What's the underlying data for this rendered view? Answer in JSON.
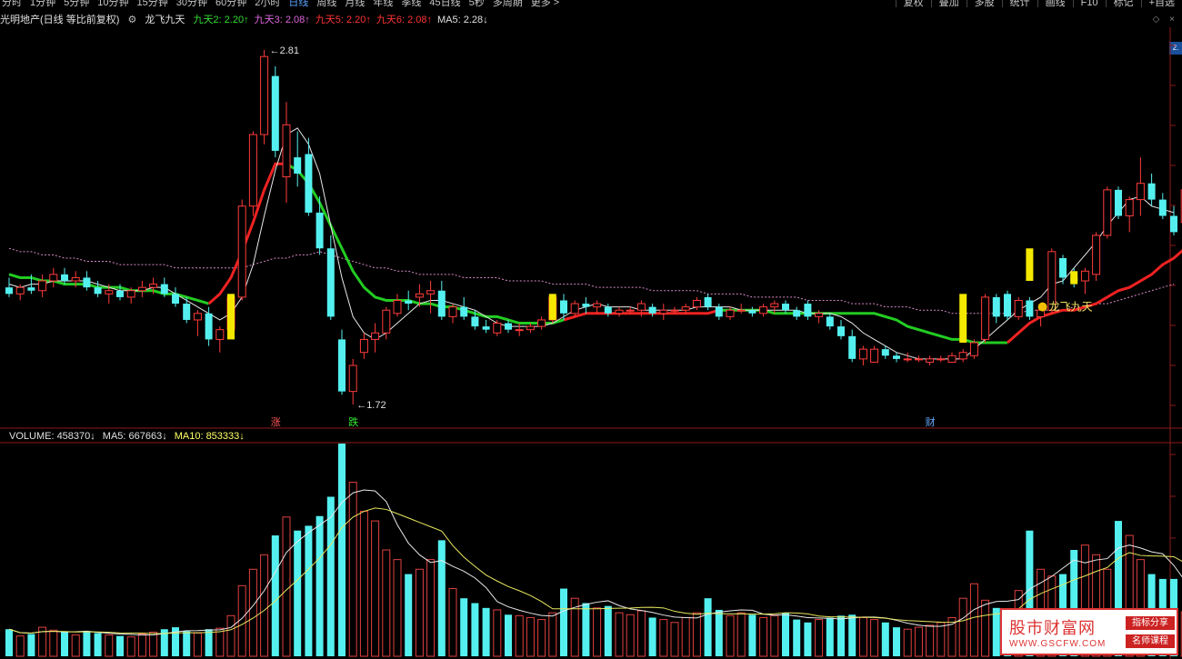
{
  "toolbar": {
    "periods": [
      "分时",
      "1分钟",
      "5分钟",
      "10分钟",
      "15分钟",
      "30分钟",
      "60分钟",
      "2小时",
      "日线",
      "周线",
      "月线",
      "年线",
      "季线",
      "45日线",
      "5秒",
      "多周期",
      "更多 >"
    ],
    "active_period": "日线",
    "tools": [
      "复权",
      "叠加",
      "多股",
      "统计",
      "画线",
      "F10",
      "标记",
      "+自选"
    ]
  },
  "info": {
    "stock": "光明地产(日线 等比前复权)",
    "indicator_name": "龙飞九天",
    "items": [
      {
        "label": "九天2: 2.20↑",
        "color": "#33dd33"
      },
      {
        "label": "九天3: 2.08↑",
        "color": "#dd66dd"
      },
      {
        "label": "九天5: 2.20↑",
        "color": "#ff3333"
      },
      {
        "label": "九天6: 2.08↑",
        "color": "#ff3333"
      },
      {
        "label": "MA5: 2.28↓",
        "color": "#e0e0e0"
      }
    ]
  },
  "price_badge": "2.",
  "annotations": {
    "high": "2.81",
    "low": "1.72",
    "signal_label": "龙飞九天",
    "markers": [
      {
        "text": "涨",
        "color": "#ff5555"
      },
      {
        "text": "跌",
        "color": "#33ee33"
      },
      {
        "text": "财",
        "color": "#66aaff"
      }
    ]
  },
  "volume": {
    "items": [
      {
        "label": "VOLUME: 458370↓",
        "color": "#e0e0e0"
      },
      {
        "label": "MA5: 667663↓",
        "color": "#e0e0e0"
      },
      {
        "label": "MA10: 853333↓",
        "color": "#ffff66"
      }
    ]
  },
  "watermark": {
    "title": "股市财富网",
    "url": "WWW.GSCFW.COM",
    "badge1": "指标分享",
    "badge2": "名师课程"
  },
  "chart_data": {
    "type": "candlestick",
    "y_range": [
      1.65,
      2.88
    ],
    "candles": [
      {
        "o": 2.08,
        "h": 2.11,
        "l": 2.05,
        "c": 2.06
      },
      {
        "o": 2.06,
        "h": 2.09,
        "l": 2.04,
        "c": 2.08
      },
      {
        "o": 2.08,
        "h": 2.12,
        "l": 2.06,
        "c": 2.07
      },
      {
        "o": 2.07,
        "h": 2.12,
        "l": 2.05,
        "c": 2.1
      },
      {
        "o": 2.1,
        "h": 2.14,
        "l": 2.08,
        "c": 2.12
      },
      {
        "o": 2.12,
        "h": 2.14,
        "l": 2.09,
        "c": 2.1
      },
      {
        "o": 2.1,
        "h": 2.13,
        "l": 2.08,
        "c": 2.11
      },
      {
        "o": 2.11,
        "h": 2.13,
        "l": 2.07,
        "c": 2.08
      },
      {
        "o": 2.08,
        "h": 2.1,
        "l": 2.05,
        "c": 2.06
      },
      {
        "o": 2.06,
        "h": 2.09,
        "l": 2.03,
        "c": 2.07
      },
      {
        "o": 2.07,
        "h": 2.09,
        "l": 2.04,
        "c": 2.05
      },
      {
        "o": 2.05,
        "h": 2.08,
        "l": 2.03,
        "c": 2.07
      },
      {
        "o": 2.07,
        "h": 2.1,
        "l": 2.05,
        "c": 2.08
      },
      {
        "o": 2.08,
        "h": 2.11,
        "l": 2.06,
        "c": 2.09
      },
      {
        "o": 2.09,
        "h": 2.11,
        "l": 2.05,
        "c": 2.06
      },
      {
        "o": 2.06,
        "h": 2.08,
        "l": 2.02,
        "c": 2.03
      },
      {
        "o": 2.03,
        "h": 2.05,
        "l": 1.97,
        "c": 1.98
      },
      {
        "o": 1.98,
        "h": 2.01,
        "l": 1.93,
        "c": 2.0
      },
      {
        "o": 2.0,
        "h": 2.02,
        "l": 1.9,
        "c": 1.92
      },
      {
        "o": 1.92,
        "h": 1.96,
        "l": 1.88,
        "c": 1.95
      },
      {
        "o": 1.95,
        "h": 2.06,
        "l": 1.94,
        "c": 2.05
      },
      {
        "o": 2.05,
        "h": 2.35,
        "l": 2.04,
        "c": 2.33
      },
      {
        "o": 2.33,
        "h": 2.56,
        "l": 2.3,
        "c": 2.55
      },
      {
        "o": 2.55,
        "h": 2.81,
        "l": 2.52,
        "c": 2.79
      },
      {
        "o": 2.73,
        "h": 2.76,
        "l": 2.48,
        "c": 2.5
      },
      {
        "o": 2.42,
        "h": 2.65,
        "l": 2.34,
        "c": 2.58
      },
      {
        "o": 2.48,
        "h": 2.56,
        "l": 2.39,
        "c": 2.43
      },
      {
        "o": 2.49,
        "h": 2.54,
        "l": 2.3,
        "c": 2.31
      },
      {
        "o": 2.31,
        "h": 2.36,
        "l": 2.18,
        "c": 2.2
      },
      {
        "o": 2.2,
        "h": 2.24,
        "l": 1.98,
        "c": 1.99
      },
      {
        "o": 1.92,
        "h": 1.95,
        "l": 1.75,
        "c": 1.76
      },
      {
        "o": 1.76,
        "h": 1.86,
        "l": 1.72,
        "c": 1.84
      },
      {
        "o": 1.88,
        "h": 1.94,
        "l": 1.86,
        "c": 1.92
      },
      {
        "o": 1.92,
        "h": 1.97,
        "l": 1.88,
        "c": 1.94
      },
      {
        "o": 1.94,
        "h": 2.02,
        "l": 1.92,
        "c": 2.01
      },
      {
        "o": 2.0,
        "h": 2.06,
        "l": 1.99,
        "c": 2.04
      },
      {
        "o": 2.04,
        "h": 2.07,
        "l": 2.01,
        "c": 2.03
      },
      {
        "o": 2.05,
        "h": 2.09,
        "l": 2.02,
        "c": 2.06
      },
      {
        "o": 2.06,
        "h": 2.1,
        "l": 2.0,
        "c": 2.07
      },
      {
        "o": 2.07,
        "h": 2.1,
        "l": 1.98,
        "c": 1.99
      },
      {
        "o": 1.99,
        "h": 2.03,
        "l": 1.97,
        "c": 2.02
      },
      {
        "o": 2.02,
        "h": 2.05,
        "l": 1.98,
        "c": 1.99
      },
      {
        "o": 1.99,
        "h": 2.01,
        "l": 1.95,
        "c": 1.96
      },
      {
        "o": 1.96,
        "h": 1.98,
        "l": 1.94,
        "c": 1.95
      },
      {
        "o": 1.94,
        "h": 1.98,
        "l": 1.93,
        "c": 1.97
      },
      {
        "o": 1.97,
        "h": 1.98,
        "l": 1.94,
        "c": 1.95
      },
      {
        "o": 1.95,
        "h": 1.97,
        "l": 1.93,
        "c": 1.95
      },
      {
        "o": 1.95,
        "h": 1.97,
        "l": 1.94,
        "c": 1.96
      },
      {
        "o": 1.96,
        "h": 1.99,
        "l": 1.95,
        "c": 1.98
      },
      {
        "o": 1.98,
        "h": 2.06,
        "l": 1.97,
        "c": 2.05
      },
      {
        "o": 2.04,
        "h": 2.06,
        "l": 1.98,
        "c": 2.0
      },
      {
        "o": 2.0,
        "h": 2.04,
        "l": 1.99,
        "c": 2.03
      },
      {
        "o": 2.03,
        "h": 2.05,
        "l": 2.0,
        "c": 2.02
      },
      {
        "o": 2.02,
        "h": 2.04,
        "l": 2.0,
        "c": 2.03
      },
      {
        "o": 2.02,
        "h": 2.03,
        "l": 1.99,
        "c": 2.0
      },
      {
        "o": 2.0,
        "h": 2.02,
        "l": 1.99,
        "c": 2.01
      },
      {
        "o": 2.01,
        "h": 2.02,
        "l": 2.0,
        "c": 2.01
      },
      {
        "o": 2.01,
        "h": 2.04,
        "l": 1.99,
        "c": 2.03
      },
      {
        "o": 2.02,
        "h": 2.03,
        "l": 1.99,
        "c": 2.0
      },
      {
        "o": 2.0,
        "h": 2.03,
        "l": 1.98,
        "c": 2.01
      },
      {
        "o": 2.01,
        "h": 2.02,
        "l": 2.0,
        "c": 2.01
      },
      {
        "o": 2.01,
        "h": 2.03,
        "l": 2.0,
        "c": 2.02
      },
      {
        "o": 2.02,
        "h": 2.05,
        "l": 2.01,
        "c": 2.04
      },
      {
        "o": 2.05,
        "h": 2.06,
        "l": 2.01,
        "c": 2.02
      },
      {
        "o": 2.02,
        "h": 2.03,
        "l": 1.98,
        "c": 1.99
      },
      {
        "o": 1.99,
        "h": 2.02,
        "l": 1.98,
        "c": 2.01
      },
      {
        "o": 2.01,
        "h": 2.03,
        "l": 2.0,
        "c": 2.01
      },
      {
        "o": 2.01,
        "h": 2.02,
        "l": 1.99,
        "c": 2.0
      },
      {
        "o": 2.0,
        "h": 2.03,
        "l": 1.99,
        "c": 2.02
      },
      {
        "o": 2.02,
        "h": 2.04,
        "l": 2.0,
        "c": 2.03
      },
      {
        "o": 2.03,
        "h": 2.04,
        "l": 2.0,
        "c": 2.01
      },
      {
        "o": 2.01,
        "h": 2.02,
        "l": 1.98,
        "c": 1.99
      },
      {
        "o": 2.03,
        "h": 2.04,
        "l": 1.98,
        "c": 1.99
      },
      {
        "o": 1.99,
        "h": 2.01,
        "l": 1.97,
        "c": 2.0
      },
      {
        "o": 1.99,
        "h": 2.0,
        "l": 1.95,
        "c": 1.96
      },
      {
        "o": 1.96,
        "h": 1.98,
        "l": 1.92,
        "c": 1.93
      },
      {
        "o": 1.93,
        "h": 1.95,
        "l": 1.85,
        "c": 1.86
      },
      {
        "o": 1.86,
        "h": 1.9,
        "l": 1.84,
        "c": 1.89
      },
      {
        "o": 1.85,
        "h": 1.9,
        "l": 1.85,
        "c": 1.89
      },
      {
        "o": 1.89,
        "h": 1.9,
        "l": 1.86,
        "c": 1.87
      },
      {
        "o": 1.87,
        "h": 1.88,
        "l": 1.85,
        "c": 1.86
      },
      {
        "o": 1.86,
        "h": 1.88,
        "l": 1.85,
        "c": 1.86
      },
      {
        "o": 1.86,
        "h": 1.87,
        "l": 1.85,
        "c": 1.86
      },
      {
        "o": 1.85,
        "h": 1.87,
        "l": 1.84,
        "c": 1.86
      },
      {
        "o": 1.86,
        "h": 1.87,
        "l": 1.85,
        "c": 1.86
      },
      {
        "o": 1.85,
        "h": 1.88,
        "l": 1.85,
        "c": 1.87
      },
      {
        "o": 1.86,
        "h": 1.89,
        "l": 1.85,
        "c": 1.88
      },
      {
        "o": 1.87,
        "h": 1.92,
        "l": 1.86,
        "c": 1.91
      },
      {
        "o": 1.92,
        "h": 2.06,
        "l": 1.91,
        "c": 2.05
      },
      {
        "o": 2.05,
        "h": 2.06,
        "l": 1.97,
        "c": 1.99
      },
      {
        "o": 2.06,
        "h": 2.07,
        "l": 1.98,
        "c": 1.99
      },
      {
        "o": 1.99,
        "h": 2.05,
        "l": 1.98,
        "c": 2.04
      },
      {
        "o": 2.04,
        "h": 2.05,
        "l": 1.98,
        "c": 1.99
      },
      {
        "o": 1.99,
        "h": 2.03,
        "l": 1.96,
        "c": 2.01
      },
      {
        "o": 2.01,
        "h": 2.2,
        "l": 2.0,
        "c": 2.19
      },
      {
        "o": 2.17,
        "h": 2.18,
        "l": 2.09,
        "c": 2.11
      },
      {
        "o": 2.11,
        "h": 2.14,
        "l": 2.08,
        "c": 2.1
      },
      {
        "o": 2.1,
        "h": 2.14,
        "l": 2.06,
        "c": 2.13
      },
      {
        "o": 2.12,
        "h": 2.25,
        "l": 2.1,
        "c": 2.24
      },
      {
        "o": 2.24,
        "h": 2.39,
        "l": 2.23,
        "c": 2.38
      },
      {
        "o": 2.38,
        "h": 2.39,
        "l": 2.29,
        "c": 2.3
      },
      {
        "o": 2.3,
        "h": 2.36,
        "l": 2.25,
        "c": 2.35
      },
      {
        "o": 2.35,
        "h": 2.48,
        "l": 2.3,
        "c": 2.4
      },
      {
        "o": 2.4,
        "h": 2.43,
        "l": 2.33,
        "c": 2.35
      },
      {
        "o": 2.35,
        "h": 2.37,
        "l": 2.29,
        "c": 2.3
      },
      {
        "o": 2.3,
        "h": 2.33,
        "l": 2.24,
        "c": 2.25
      },
      {
        "o": 2.28,
        "h": 2.39,
        "l": 2.25,
        "c": 2.38
      },
      {
        "o": 2.38,
        "h": 2.44,
        "l": 2.25,
        "c": 2.28
      }
    ],
    "signal_bars": [
      {
        "index": 20,
        "low": 1.92,
        "high": 2.06
      },
      {
        "index": 49,
        "low": 1.98,
        "high": 2.06
      },
      {
        "index": 86,
        "low": 1.91,
        "high": 2.06
      },
      {
        "index": 92,
        "low": 2.1,
        "high": 2.2
      },
      {
        "index": 96,
        "low": 2.09,
        "high": 2.13
      }
    ],
    "volume_range": [
      0,
      2200000
    ],
    "volume": [
      280000,
      210000,
      230000,
      300000,
      270000,
      250000,
      220000,
      260000,
      240000,
      220000,
      210000,
      200000,
      230000,
      250000,
      280000,
      300000,
      260000,
      240000,
      280000,
      290000,
      420000,
      730000,
      900000,
      1050000,
      1250000,
      1440000,
      1300000,
      1350000,
      1450000,
      1650000,
      2200000,
      1800000,
      1500000,
      1400000,
      1100000,
      1000000,
      850000,
      900000,
      1000000,
      1200000,
      700000,
      600000,
      550000,
      500000,
      480000,
      430000,
      420000,
      400000,
      380000,
      450000,
      700000,
      600000,
      550000,
      500000,
      520000,
      450000,
      430000,
      470000,
      400000,
      380000,
      350000,
      400000,
      450000,
      600000,
      480000,
      420000,
      450000,
      430000,
      400000,
      420000,
      450000,
      380000,
      350000,
      380000,
      400000,
      420000,
      430000,
      400000,
      380000,
      350000,
      300000,
      280000,
      300000,
      320000,
      350000,
      400000,
      600000,
      750000,
      580000,
      500000,
      420000,
      680000,
      1300000,
      900000,
      830000,
      850000,
      1100000,
      1150000,
      1050000,
      900000,
      1400000,
      1250000,
      1000000,
      850000,
      800000,
      800000,
      460000
    ],
    "price_lines": {
      "ma5_white": [
        2.09,
        2.08,
        2.09,
        2.09,
        2.1,
        2.1,
        2.1,
        2.1,
        2.09,
        2.08,
        2.07,
        2.07,
        2.07,
        2.08,
        2.08,
        2.06,
        2.04,
        2.02,
        2.0,
        1.98,
        2.0,
        2.05,
        2.15,
        2.3,
        2.44,
        2.55,
        2.57,
        2.52,
        2.43,
        2.27,
        2.11,
        1.99,
        1.94,
        1.92,
        1.94,
        1.97,
        2.0,
        2.03,
        2.04,
        2.04,
        2.03,
        2.02,
        2.01,
        1.99,
        1.97,
        1.96,
        1.96,
        1.96,
        1.96,
        1.97,
        1.99,
        2.01,
        2.02,
        2.03,
        2.02,
        2.02,
        2.02,
        2.01,
        2.01,
        2.01,
        2.01,
        2.01,
        2.02,
        2.02,
        2.02,
        2.02,
        2.01,
        2.01,
        2.01,
        2.01,
        2.01,
        2.01,
        2.0,
        2.0,
        2.0,
        1.99,
        1.97,
        1.94,
        1.92,
        1.9,
        1.88,
        1.87,
        1.86,
        1.86,
        1.86,
        1.86,
        1.86,
        1.89,
        1.92,
        1.95,
        1.98,
        2.01,
        2.03,
        2.05,
        2.09,
        2.1,
        2.14,
        2.18,
        2.22,
        2.27,
        2.31,
        2.35,
        2.36,
        2.33,
        2.32,
        2.31
      ],
      "green": [
        2.12,
        2.11,
        2.11,
        2.1,
        2.1,
        2.09,
        2.09,
        2.09,
        2.08,
        2.08,
        2.08,
        2.07,
        2.07,
        2.07,
        2.06,
        2.06,
        2.05,
        2.04,
        2.03
      ],
      "red": [
        2.03,
        2.06,
        2.11,
        2.19,
        2.28,
        2.38,
        2.46,
        2.46
      ],
      "green2": [
        2.46,
        2.44,
        2.4,
        2.34,
        2.27,
        2.2,
        2.13,
        2.08,
        2.05,
        2.04,
        2.04,
        2.04,
        2.03,
        2.03,
        2.02,
        2.02,
        2.01,
        2.0,
        1.99,
        1.99,
        1.98,
        1.97,
        1.97,
        1.97,
        1.97,
        1.98
      ],
      "red2": [
        1.98,
        1.99,
        2.0,
        2.0,
        2.0,
        2.0,
        2.0,
        2.0,
        2.0,
        2.0,
        2.0,
        2.0,
        2.0,
        2.0,
        2.01
      ],
      "green3": [
        2.01,
        2.01,
        2.01,
        2.01,
        2.01,
        2.0,
        2.0,
        2.0,
        2.0,
        2.0,
        2.0,
        2.0,
        2.0,
        2.0,
        2.0,
        1.99,
        1.98,
        1.96,
        1.95,
        1.94,
        1.93,
        1.92,
        1.92,
        1.91,
        1.91,
        1.91,
        1.91
      ],
      "red3": [
        1.91,
        1.94,
        1.97,
        1.99,
        2.0,
        2.01,
        2.01,
        2.02,
        2.03,
        2.05,
        2.07,
        2.08,
        2.1,
        2.12,
        2.15,
        2.17,
        2.2,
        2.22,
        2.23,
        2.23,
        2.23
      ],
      "pink_dotted": [
        2.2,
        2.19,
        2.19,
        2.18,
        2.18,
        2.17,
        2.17,
        2.16,
        2.16,
        2.16,
        2.15,
        2.15,
        2.15,
        2.15,
        2.15,
        2.14,
        2.14,
        2.14,
        2.14,
        2.14,
        2.14,
        2.14,
        2.15,
        2.16,
        2.17,
        2.17,
        2.18,
        2.18,
        2.19,
        2.18,
        2.17,
        2.16,
        2.15,
        2.14,
        2.14,
        2.13,
        2.13,
        2.12,
        2.12,
        2.12,
        2.12,
        2.11,
        2.11,
        2.11,
        2.11,
        2.1,
        2.1,
        2.1,
        2.1,
        2.09,
        2.09,
        2.09,
        2.09,
        2.08,
        2.08,
        2.08,
        2.08,
        2.08,
        2.07,
        2.07,
        2.07,
        2.07,
        2.07,
        2.06,
        2.06,
        2.06,
        2.06,
        2.05,
        2.05,
        2.05,
        2.05,
        2.05,
        2.04,
        2.04,
        2.04,
        2.04,
        2.03,
        2.03,
        2.03,
        2.02,
        2.02,
        2.02,
        2.01,
        2.01,
        2.01,
        2.0,
        2.0,
        2.0,
        2.0,
        2.0,
        2.0,
        2.0,
        2.01,
        2.01,
        2.01,
        2.01,
        2.02,
        2.02,
        2.03,
        2.03,
        2.04,
        2.05,
        2.06,
        2.07,
        2.08,
        2.09
      ]
    }
  }
}
